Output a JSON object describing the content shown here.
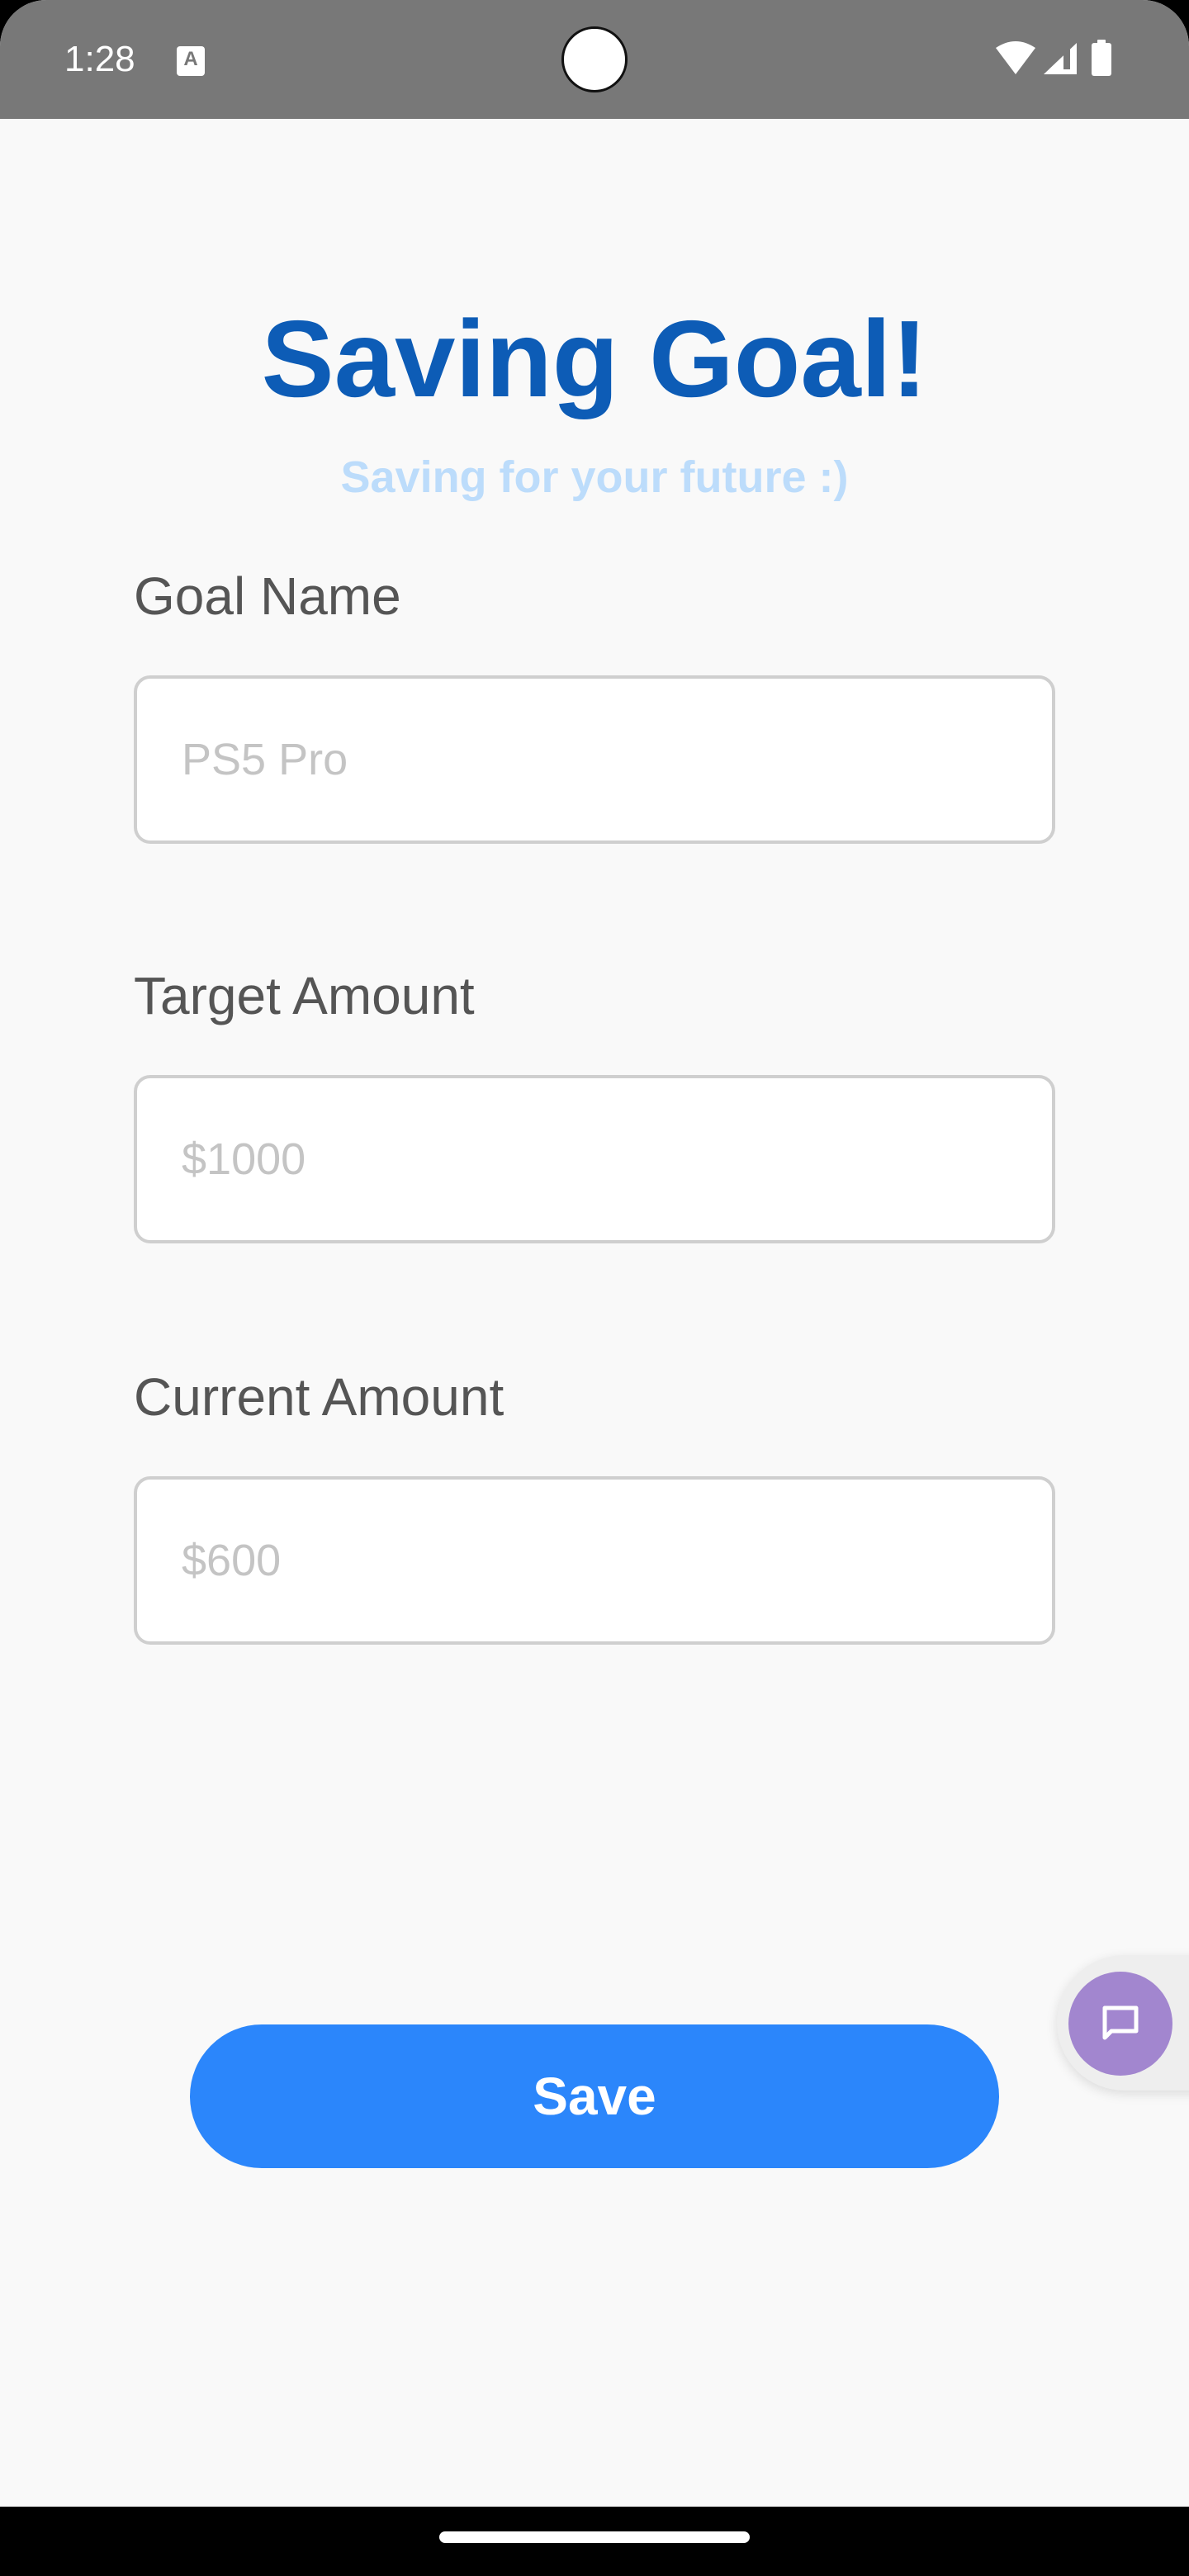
{
  "status_bar": {
    "time": "1:28",
    "notification_icon": "a-letter-icon",
    "notification_letter": "A",
    "icons": [
      "wifi-icon",
      "signal-icon",
      "battery-icon"
    ]
  },
  "header": {
    "title": "Saving Goal!",
    "subtitle": "Saving for your future :)"
  },
  "form": {
    "fields": [
      {
        "label": "Goal Name",
        "value": "",
        "placeholder": "PS5 Pro"
      },
      {
        "label": "Target Amount",
        "value": "",
        "placeholder": "$1000"
      },
      {
        "label": "Current Amount",
        "value": "",
        "placeholder": "$600"
      }
    ],
    "save_label": "Save"
  },
  "fab": {
    "icon": "chat-bubble-icon"
  },
  "colors": {
    "title": "#0d5cb6",
    "subtitle": "#bcdcfb",
    "primary_button": "#2b86fb",
    "fab": "#a286cf",
    "status_bar": "#787878"
  }
}
